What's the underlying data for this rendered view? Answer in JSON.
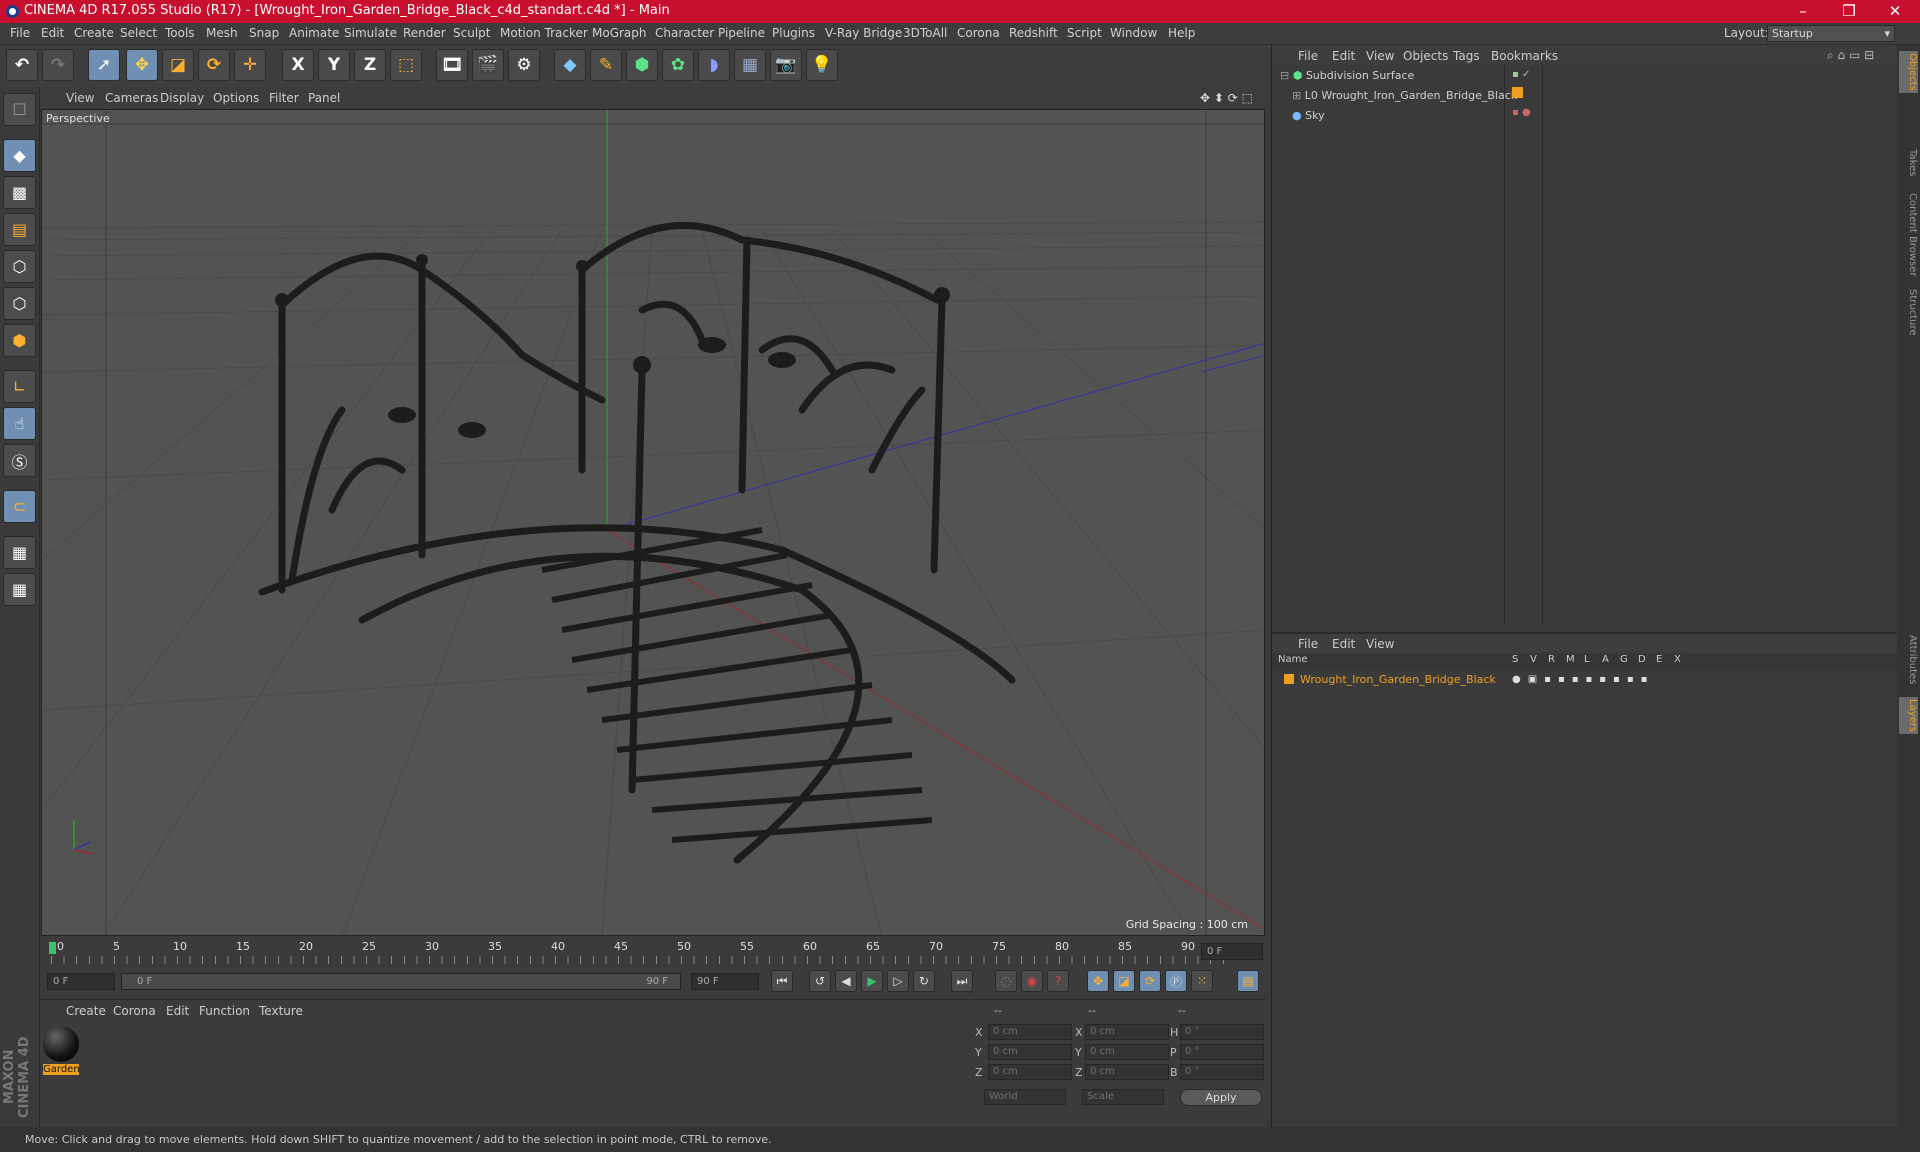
{
  "app": {
    "title": "CINEMA 4D R17.055 Studio (R17) - [Wrought_Iron_Garden_Bridge_Black_c4d_standart.c4d *] - Main"
  },
  "menubar": [
    "File",
    "Edit",
    "Create",
    "Select",
    "Tools",
    "Mesh",
    "Snap",
    "Animate",
    "Simulate",
    "Render",
    "Sculpt",
    "Motion Tracker",
    "MoGraph",
    "Character",
    "Pipeline",
    "Plugins",
    "V-Ray Bridge",
    "3DToAll",
    "Corona",
    "Redshift",
    "Script",
    "Window",
    "Help"
  ],
  "layout": {
    "label": "Layout:",
    "value": "Startup"
  },
  "toolbar": {
    "x_label": "X",
    "y_label": "Y",
    "z_label": "Z"
  },
  "viewport": {
    "menu": [
      "View",
      "Cameras",
      "Display",
      "Options",
      "Filter",
      "Panel"
    ],
    "label": "Perspective",
    "grid_spacing": "Grid Spacing : 100 cm"
  },
  "timeline": {
    "ticks": [
      "0",
      "5",
      "10",
      "15",
      "20",
      "25",
      "30",
      "35",
      "40",
      "45",
      "50",
      "55",
      "60",
      "65",
      "70",
      "75",
      "80",
      "85",
      "90"
    ],
    "current_frame": "0 F"
  },
  "playbar": {
    "start": "0 F",
    "slider_start": "0 F",
    "slider_end": "90 F",
    "end": "90 F"
  },
  "materials": {
    "menu": [
      "Create",
      "Corona",
      "Edit",
      "Function",
      "Texture"
    ],
    "items": [
      {
        "name": "Garden"
      }
    ]
  },
  "coords": {
    "headers": [
      "--",
      "--",
      "--"
    ],
    "rows": [
      {
        "a": "X",
        "av": "0 cm",
        "b": "X",
        "bv": "0 cm",
        "c": "H",
        "cv": "0 °"
      },
      {
        "a": "Y",
        "av": "0 cm",
        "b": "Y",
        "bv": "0 cm",
        "c": "P",
        "cv": "0 °"
      },
      {
        "a": "Z",
        "av": "0 cm",
        "b": "Z",
        "bv": "0 cm",
        "c": "B",
        "cv": "0 °"
      }
    ],
    "world": "World",
    "scale": "Scale",
    "apply": "Apply"
  },
  "objects_panel": {
    "menu": [
      "File",
      "Edit",
      "View",
      "Objects",
      "Tags",
      "Bookmarks"
    ],
    "items": [
      {
        "name": "Subdivision Surface"
      },
      {
        "name": "Wrought_Iron_Garden_Bridge_Black"
      },
      {
        "name": "Sky"
      }
    ]
  },
  "layers_panel": {
    "menu": [
      "File",
      "Edit",
      "View"
    ],
    "header_name": "Name",
    "header_flags": [
      "S",
      "V",
      "R",
      "M",
      "L",
      "A",
      "G",
      "D",
      "E",
      "X"
    ],
    "items": [
      {
        "name": "Wrought_Iron_Garden_Bridge_Black"
      }
    ]
  },
  "right_tabs": [
    "Objects",
    "Takes",
    "Content Browser",
    "Structure",
    "Attributes",
    "Layers"
  ],
  "status": "Move: Click and drag to move elements. Hold down SHIFT to quantize movement / add to the selection in point mode, CTRL to remove.",
  "colors": {
    "titlebar": "#c8102e",
    "accent_orange": "#f0a020",
    "selected_blue": "#6f8fb3"
  }
}
